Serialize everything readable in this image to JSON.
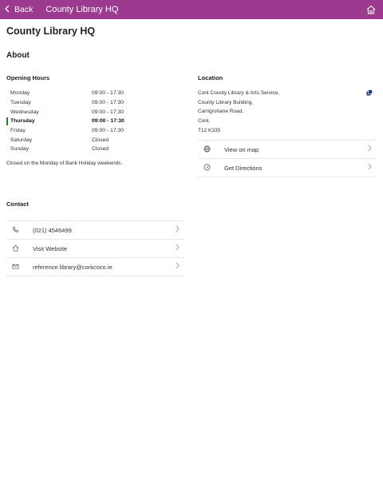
{
  "header": {
    "back_label": "Back",
    "title": "County Library HQ"
  },
  "page_title": "County Library HQ",
  "about_heading": "About",
  "opening_hours": {
    "heading": "Opening Hours",
    "days": [
      {
        "day": "Monday",
        "time": "09:00 - 17:30"
      },
      {
        "day": "Tuesday",
        "time": "09:00 - 17:30"
      },
      {
        "day": "Wednesday",
        "time": "09:00 - 17:30"
      },
      {
        "day": "Thursday",
        "time": "09:00 - 17:30"
      },
      {
        "day": "Friday",
        "time": "09:00 - 17:30"
      },
      {
        "day": "Saturday",
        "time": "Closed"
      },
      {
        "day": "Sunday",
        "time": "Closed"
      }
    ],
    "note": "Closed on the Monday of Bank Holiday weekends."
  },
  "location": {
    "heading": "Location",
    "address_lines": [
      "Cork County Library & Arts Service,",
      "County Library Building,",
      "Carrigrohane Road,",
      "Cork.",
      "T12 K335"
    ],
    "view_on_map": "View on map",
    "get_directions": "Get Directions"
  },
  "contact": {
    "heading": "Contact",
    "phone": "(021) 4546499",
    "website": "Visit Website",
    "email": "reference.library@corkcoco.ie"
  },
  "colors": {
    "accent": "#9b3a8f",
    "today_marker": "#2e7d32"
  }
}
